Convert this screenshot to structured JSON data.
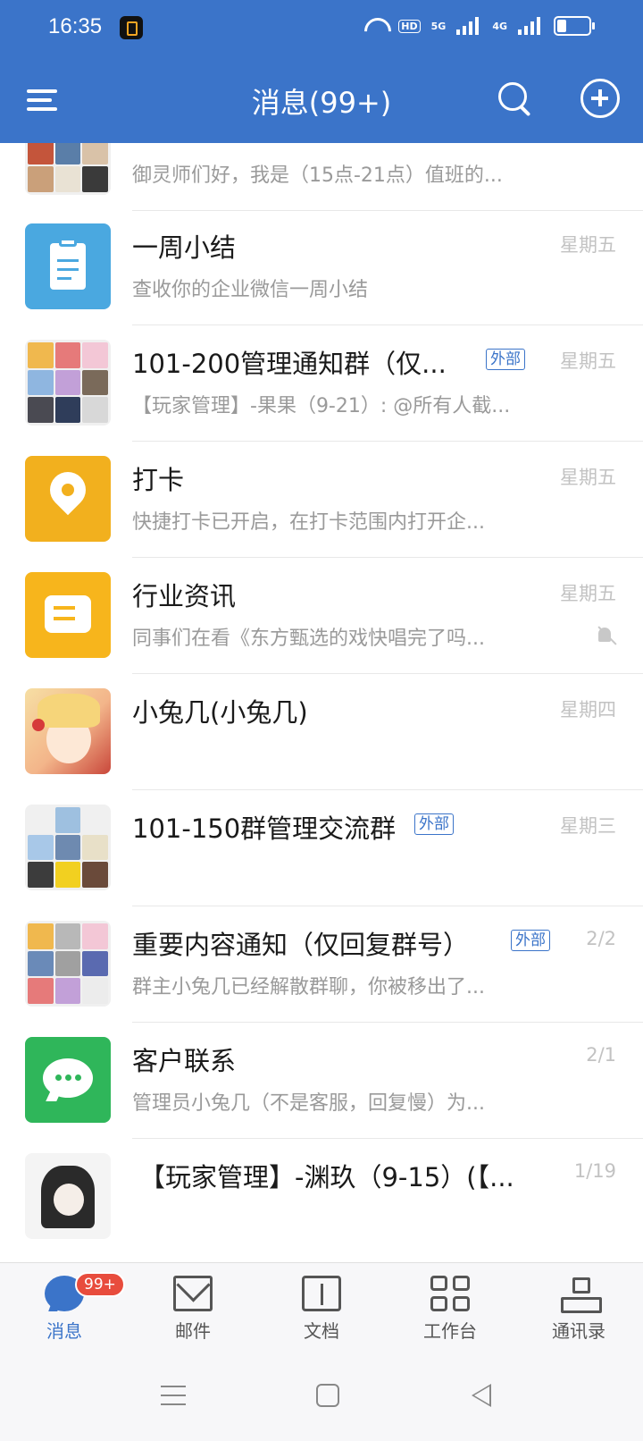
{
  "status_bar": {
    "time": "16:35",
    "hd_label": "HD",
    "net1": "5G",
    "net2": "4G"
  },
  "header": {
    "title": "消息(99+)"
  },
  "colors": {
    "brand": "#3b74c9",
    "badge": "#e84c3d",
    "tag": "#3b74c9"
  },
  "conversations": [
    {
      "name": "",
      "preview": "御灵师们好，我是（15点-21点）值班的...",
      "time": "",
      "tag": ""
    },
    {
      "name": "一周小结",
      "preview": "查收你的企业微信一周小结",
      "time": "星期五",
      "tag": "",
      "icon": "clipboard-icon"
    },
    {
      "name": "101-200管理通知群（仅...",
      "preview": "【玩家管理】-果果（9-21）: @所有人截...",
      "time": "星期五",
      "tag": "外部"
    },
    {
      "name": "打卡",
      "preview": "快捷打卡已开启，在打卡范围内打开企...",
      "time": "星期五",
      "tag": "",
      "icon": "location-pin-icon"
    },
    {
      "name": "行业资讯",
      "preview": "同事们在看《东方甄选的戏快唱完了吗...",
      "time": "星期五",
      "tag": "",
      "icon": "news-icon",
      "muted": true
    },
    {
      "name": "小兔几(小兔几)",
      "preview": "",
      "time": "星期四",
      "tag": ""
    },
    {
      "name": "101-150群管理交流群",
      "preview": "",
      "time": "星期三",
      "tag": "外部"
    },
    {
      "name": "重要内容通知（仅回复群号）",
      "preview": "群主小兔几已经解散群聊，你被移出了...",
      "time": "2/2",
      "tag": "外部"
    },
    {
      "name": "客户联系",
      "preview": "管理员小兔几（不是客服，回复慢）为...",
      "time": "2/1",
      "tag": "",
      "icon": "chat-bubble-icon"
    },
    {
      "name": "【玩家管理】-渊玖（9-15）(【...",
      "preview": "",
      "time": "1/19",
      "tag": ""
    }
  ],
  "tabs": [
    {
      "label": "消息",
      "icon": "message-icon",
      "badge": "99+"
    },
    {
      "label": "邮件",
      "icon": "mail-icon"
    },
    {
      "label": "文档",
      "icon": "document-icon"
    },
    {
      "label": "工作台",
      "icon": "workbench-icon"
    },
    {
      "label": "通讯录",
      "icon": "contacts-icon"
    }
  ]
}
